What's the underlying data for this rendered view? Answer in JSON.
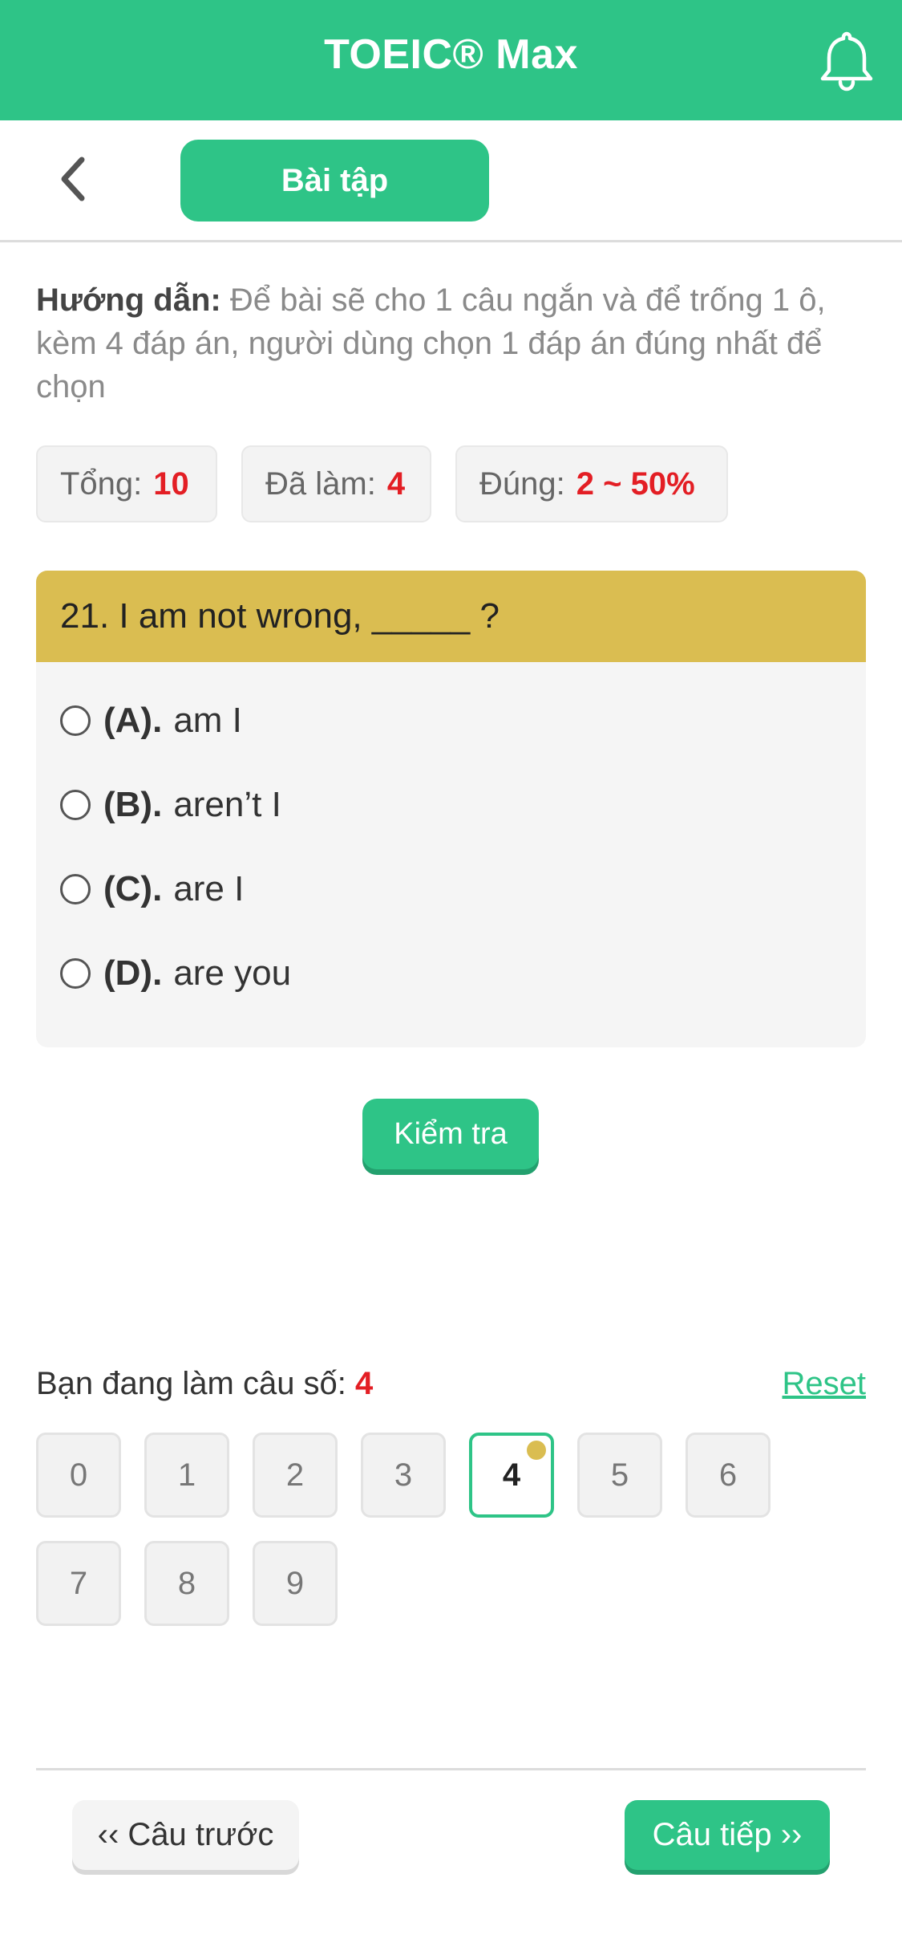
{
  "header": {
    "title": "TOEIC® Max",
    "bell_icon": "bell-icon",
    "color": "#2ec487"
  },
  "nav": {
    "back_icon": "chevron-left-icon",
    "tab_label": "Bài tập"
  },
  "instructions": {
    "label": "Hướng dẫn:",
    "text": " Để bài sẽ cho 1 câu ngắn và để trống 1 ô, kèm 4 đáp án, người dùng chọn 1 đáp án đúng nhất để chọn"
  },
  "stats": {
    "total_label": "Tổng:",
    "total_value": "10",
    "done_label": "Đã làm:",
    "done_value": "4",
    "correct_label": "Đúng:",
    "correct_value": "2 ~ 50%"
  },
  "question": {
    "text": "21. I am not wrong, _____ ?",
    "options": [
      {
        "key": "(A).",
        "text": "am I",
        "selected": false
      },
      {
        "key": "(B).",
        "text": "aren’t I",
        "selected": false
      },
      {
        "key": "(C).",
        "text": "are I",
        "selected": false
      },
      {
        "key": "(D).",
        "text": "are you",
        "selected": false
      }
    ]
  },
  "check_button": "Kiểm tra",
  "progress": {
    "label": "Bạn đang làm câu số:",
    "current": "4",
    "reset_label": "Reset"
  },
  "question_numbers": [
    "0",
    "1",
    "2",
    "3",
    "4",
    "5",
    "6",
    "7",
    "8",
    "9"
  ],
  "current_index": 4,
  "footer": {
    "prev_label": "‹‹ Câu trước",
    "next_label": "Câu tiếp ››"
  },
  "colors": {
    "accent": "#2ec487",
    "question_header": "#dabd51",
    "highlight_red": "#e31e24"
  }
}
